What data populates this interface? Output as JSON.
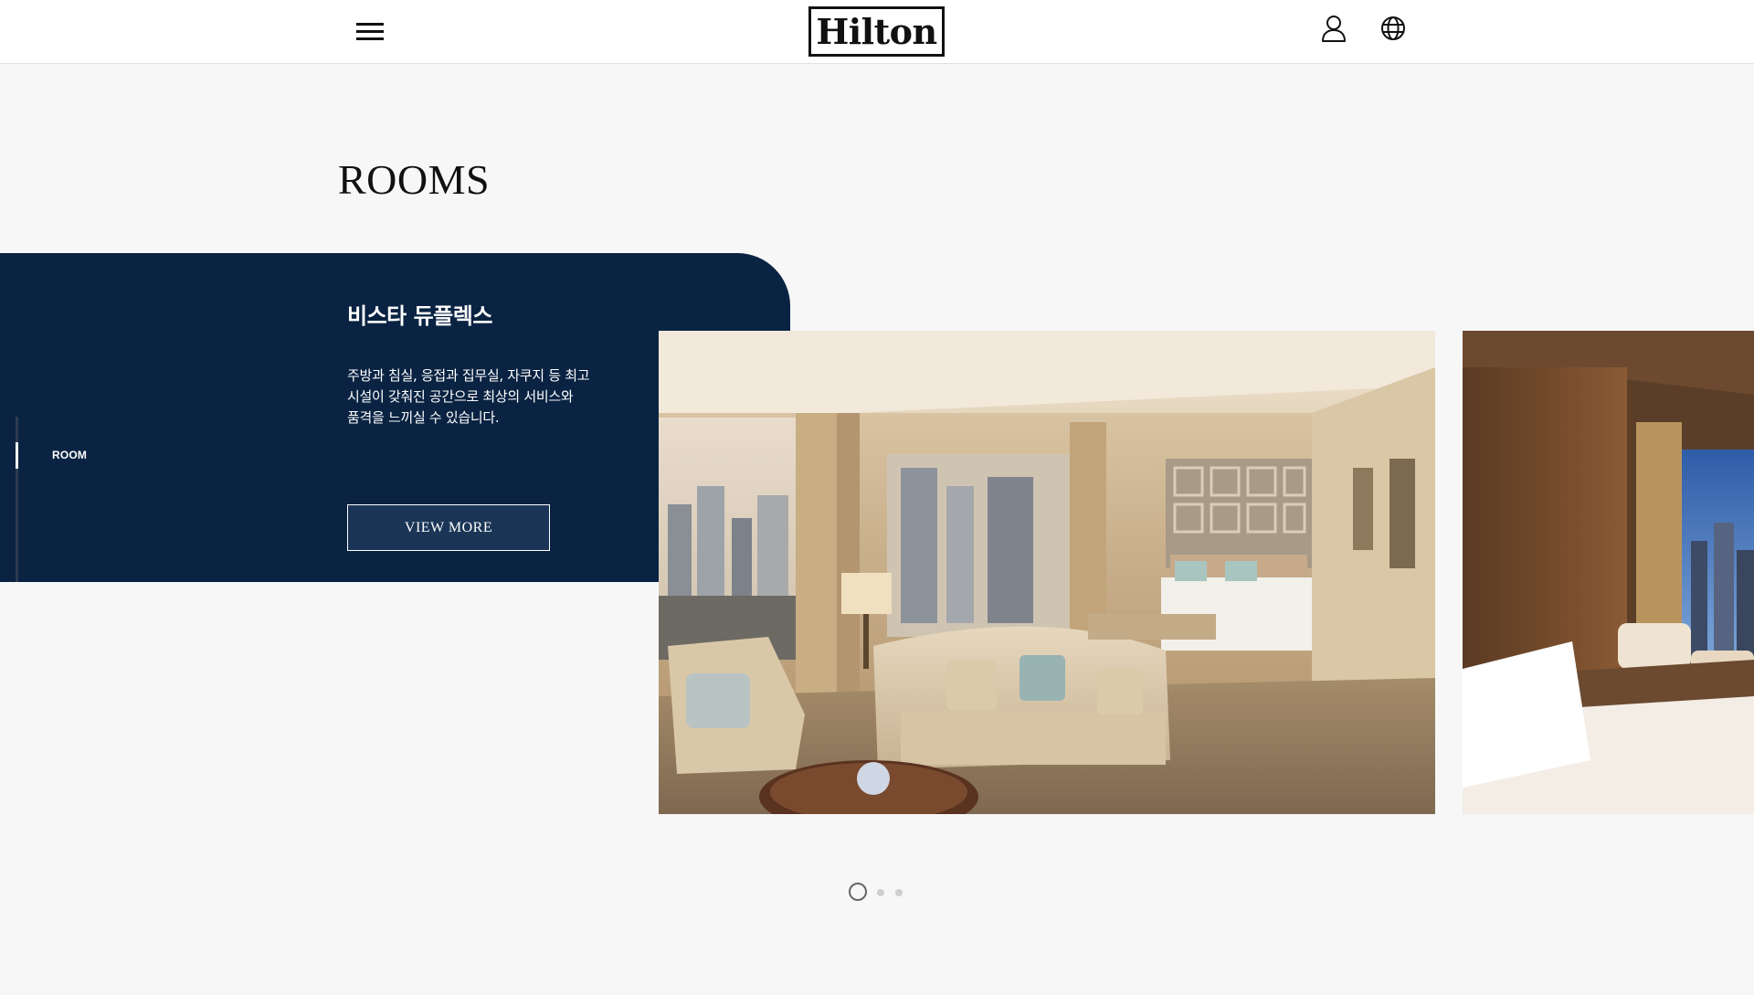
{
  "header": {
    "logo_text": "Hilton",
    "menu_icon": "hamburger-menu-icon",
    "user_icon": "user-icon",
    "language_icon": "globe-icon"
  },
  "section": {
    "title": "ROOMS"
  },
  "sidebar": {
    "active_label": "ROOM"
  },
  "room": {
    "title": "비스타 듀플렉스",
    "description": "주방과 침실, 응접과 집무실, 자쿠지 등 최고 시설이 갖춰진 공간으로 최상의 서비스와 품격을 느끼실 수 있습니다.",
    "button_label": "VIEW MORE"
  },
  "carousel": {
    "slide_count": 3,
    "active_index": 1
  },
  "colors": {
    "navy": "#0a2342",
    "background": "#f7f7f7",
    "white": "#ffffff"
  }
}
